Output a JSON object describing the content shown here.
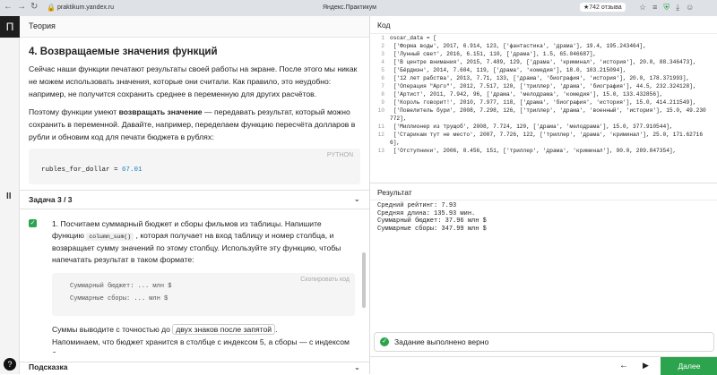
{
  "browser": {
    "url": "praktikum.yandex.ru",
    "title": "Яндекс.Практикум",
    "rating": "★742 отзыва"
  },
  "rail": {
    "logo": "П",
    "pause": "II",
    "help": "?"
  },
  "theory": {
    "tab": "Теория",
    "heading": "4. Возвращаемые значения функций",
    "p1": "Сейчас наши функции печатают результаты своей работы на экране. После этого мы никак не можем использовать значения, которые они считали. Как правило, это неудобно: например, не получится сохранить среднее в переменную для других расчётов.",
    "p2_a": "Поэтому функции умеют ",
    "p2_b": "возвращать значение",
    "p2_c": " — передавать результат, который можно сохранить в переменной. Давайте, например, переделаем функцию пересчёта долларов в рубли и обновим код для печати бюджета в рублях:",
    "code_lang": "PYTHON",
    "code_var": "rubles_for_dollar = ",
    "code_num": "67.01"
  },
  "task": {
    "header": "Задача  3 / 3",
    "t1": "1. Посчитаем суммарный бюджет и сборы фильмов из таблицы. Напишите функцию ",
    "fn": "column_sum()",
    "t2": " , которая получает на вход таблицу и номер столбца, и возвращает сумму значений по этому столбцу. Используйте эту функцию, чтобы напечатать результат в таком формате:",
    "copy": "Скопировать код",
    "fmt1": "Суммарный бюджет: ... млн $",
    "fmt2": "Суммарные сборы: ... млн $",
    "p1": "Суммы выводите с точностью до ",
    "tag": "двух знаков после запятой",
    "p1e": ".",
    "p2": "Напоминаем, что бюджет хранится в столбце с индексом 5, а сборы — с индексом 6."
  },
  "hint": "Подсказка",
  "code": {
    "header": "Код",
    "lines": [
      {
        "n": "1",
        "t": "oscar_data = ["
      },
      {
        "n": "2",
        "t": "    ['Форма воды', 2017, 6.914, 123, ['фантастика', 'драма'], 19.4, 195.243464],"
      },
      {
        "n": "3",
        "t": "    ['Лунный свет', 2016, 6.151, 110, ['драма'], 1.5, 65.046687],"
      },
      {
        "n": "4",
        "t": "    ['В центре внимания', 2015, 7.489, 129, ['драма', 'криминал', 'история'], 20.0, 88.346473],"
      },
      {
        "n": "5",
        "t": "    ['Бёрдмэн', 2014, 7.604, 119, ['драма', 'комедия'], 18.0, 103.215094],"
      },
      {
        "n": "6",
        "t": "    ['12 лет рабства', 2013, 7.71, 133, ['драма', 'биография', 'история'], 20.0, 178.371993],"
      },
      {
        "n": "7",
        "t": "    ['Операция \"Арго\"', 2012, 7.517, 120, ['триллер', 'драма', 'биография'], 44.5, 232.324128],"
      },
      {
        "n": "8",
        "t": "    ['Артист', 2011, 7.942, 96, ['драма', 'мелодрама', 'комедия'], 15.0, 133.432856],"
      },
      {
        "n": "9",
        "t": "    ['Король говорит!', 2010, 7.977, 118, ['драма', 'биография', 'история'], 15.0, 414.211549],"
      },
      {
        "n": "10",
        "t": "    ['Повелитель бури', 2008, 7.298, 126, ['триллер', 'драма', 'военный', 'история'], 15.0, 49.230"
      },
      {
        "n": "",
        "t": "772],"
      },
      {
        "n": "11",
        "t": "    ['Миллионер из трущоб', 2008, 7.724, 120, ['драма', 'мелодрама'], 15.0, 377.910544],"
      },
      {
        "n": "12",
        "t": "    ['Старикам тут не место', 2007, 7.726, 122, ['триллер', 'драма', 'криминал'], 25.0, 171.62716"
      },
      {
        "n": "",
        "t": "6],"
      },
      {
        "n": "13",
        "t": "    ['Отступники', 2006, 8.456, 151, ['триллер', 'драма', 'криминал'], 90.0, 289.847354],"
      }
    ]
  },
  "result": {
    "header": "Результат",
    "lines": [
      "Средний рейтинг: 7.93",
      "Средняя длина: 135.93 мин.",
      "Суммарный бюджет: 37.96 млн $",
      "Суммарные сборы: 347.99 млн $"
    ]
  },
  "status": "Задание выполнено верно",
  "next_label": "Далее",
  "colors": {
    "accent": "#2ca44e"
  }
}
